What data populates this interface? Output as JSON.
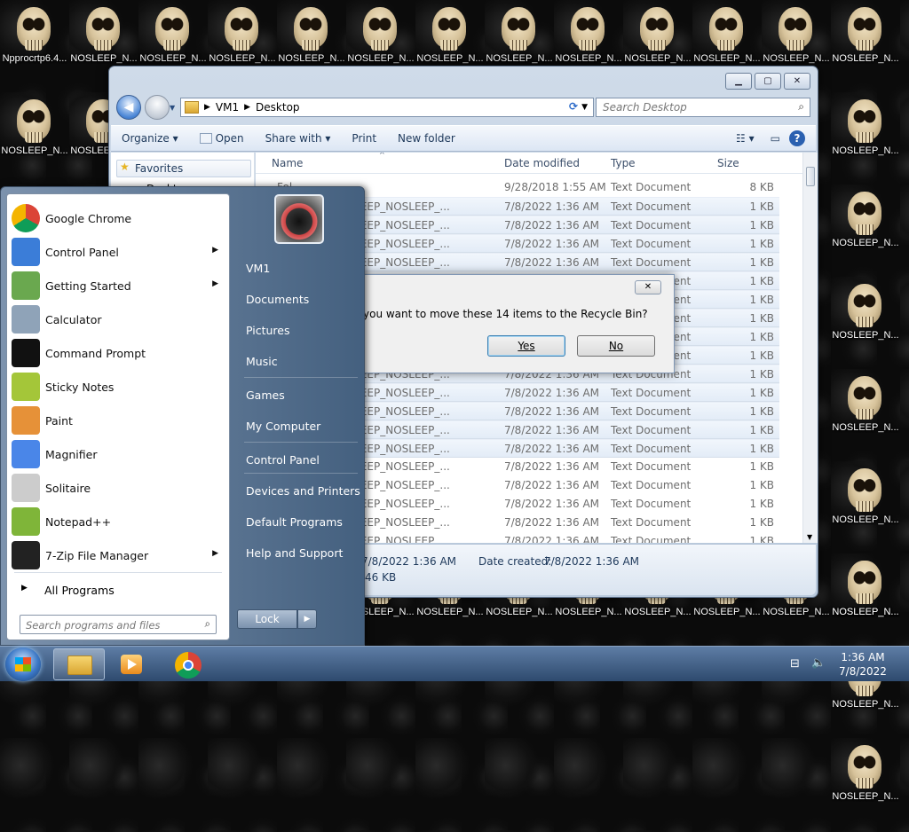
{
  "desktop": {
    "top_row": [
      "NOSLEEP_N...",
      "NOSLEEP_N...",
      "NOSLEEP_N...",
      "NOSLEEP_N...",
      "NOSLEEP_N...",
      "NOSLEEP_N...",
      "NOSLEEP_N...",
      "NOSLEEP_N...",
      "NOSLEEP_N...",
      "NOSLEEP_N...",
      "NOSLEEP_N...",
      "NOSLEEP_N...",
      "NOSLEEP_N..."
    ],
    "first_icon_label": "Npprocrtp6.4...",
    "left_col": [
      "NOSLEEP_N...",
      "NOSLEEP_N..."
    ],
    "right_col": [
      "NOSLEEP_N...",
      "NOSLEEP_N...",
      "NOSLEEP_N...",
      "NOSLEEP_N...",
      "NOSLEEP_N...",
      "NOSLEEP_N...",
      "NOSLEEP_N...",
      "NOSLEEP_N..."
    ],
    "bottom_row": [
      "NOSLEEP_N...",
      "NOSLEEP_N...",
      "NOSLEEP_N...",
      "NOSLEEP_N...",
      "NOSLEEP_N...",
      "NOSLEEP_N...",
      "NOSLEEP_N...",
      "NOSLEEP_N..."
    ]
  },
  "explorer": {
    "breadcrumb": [
      "VM1",
      "Desktop"
    ],
    "search_placeholder": "Search Desktop",
    "toolbar": {
      "organize": "Organize",
      "open": "Open",
      "share": "Share with",
      "print": "Print",
      "new_folder": "New folder"
    },
    "nav": {
      "favorites": "Favorites",
      "desktop": "Desktop"
    },
    "columns": {
      "name": "Name",
      "date": "Date modified",
      "type": "Type",
      "size": "Size"
    },
    "rows": [
      {
        "name": "Fol...",
        "date": "9/28/2018 1:55 AM",
        "type": "Text Document",
        "size": "8 KB",
        "sel": false
      },
      {
        "name": "NOSLEEP_NOSLEEP_NOSLEEP_...",
        "date": "7/8/2022 1:36 AM",
        "type": "Text Document",
        "size": "1 KB",
        "sel": true
      },
      {
        "name": "NOSLEEP_NOSLEEP_NOSLEEP_...",
        "date": "7/8/2022 1:36 AM",
        "type": "Text Document",
        "size": "1 KB",
        "sel": true
      },
      {
        "name": "NOSLEEP_NOSLEEP_NOSLEEP_...",
        "date": "7/8/2022 1:36 AM",
        "type": "Text Document",
        "size": "1 KB",
        "sel": true
      },
      {
        "name": "NOSLEEP_NOSLEEP_NOSLEEP_...",
        "date": "7/8/2022 1:36 AM",
        "type": "Text Document",
        "size": "1 KB",
        "sel": true
      },
      {
        "name": "NOSLEEP_NOSLEEP_NOSLEEP_...",
        "date": "7/8/2022 1:36 AM",
        "type": "Text Document",
        "size": "1 KB",
        "sel": true
      },
      {
        "name": "NOSLEEP_NOSLEEP_NOSLEEP_...",
        "date": "7/8/2022 1:36 AM",
        "type": "Text Document",
        "size": "1 KB",
        "sel": true
      },
      {
        "name": "NOSLEEP_NOSLEEP_NOSLEEP_...",
        "date": "7/8/2022 1:36 AM",
        "type": "Text Document",
        "size": "1 KB",
        "sel": true
      },
      {
        "name": "NOSLEEP_NOSLEEP_NOSLEEP_...",
        "date": "7/8/2022 1:36 AM",
        "type": "Text Document",
        "size": "1 KB",
        "sel": true
      },
      {
        "name": "NOSLEEP_NOSLEEP_NOSLEEP_...",
        "date": "7/8/2022 1:36 AM",
        "type": "Text Document",
        "size": "1 KB",
        "sel": true
      },
      {
        "name": "NOSLEEP_NOSLEEP_NOSLEEP_...",
        "date": "7/8/2022 1:36 AM",
        "type": "Text Document",
        "size": "1 KB",
        "sel": true
      },
      {
        "name": "NOSLEEP_NOSLEEP_NOSLEEP_...",
        "date": "7/8/2022 1:36 AM",
        "type": "Text Document",
        "size": "1 KB",
        "sel": true
      },
      {
        "name": "NOSLEEP_NOSLEEP_NOSLEEP_...",
        "date": "7/8/2022 1:36 AM",
        "type": "Text Document",
        "size": "1 KB",
        "sel": true
      },
      {
        "name": "NOSLEEP_NOSLEEP_NOSLEEP_...",
        "date": "7/8/2022 1:36 AM",
        "type": "Text Document",
        "size": "1 KB",
        "sel": true
      },
      {
        "name": "NOSLEEP_NOSLEEP_NOSLEEP_...",
        "date": "7/8/2022 1:36 AM",
        "type": "Text Document",
        "size": "1 KB",
        "sel": true
      },
      {
        "name": "NOSLEEP_NOSLEEP_NOSLEEP_...",
        "date": "7/8/2022 1:36 AM",
        "type": "Text Document",
        "size": "1 KB",
        "sel": false
      },
      {
        "name": "NOSLEEP_NOSLEEP_NOSLEEP_...",
        "date": "7/8/2022 1:36 AM",
        "type": "Text Document",
        "size": "1 KB",
        "sel": false
      },
      {
        "name": "NOSLEEP_NOSLEEP_NOSLEEP_...",
        "date": "7/8/2022 1:36 AM",
        "type": "Text Document",
        "size": "1 KB",
        "sel": false
      },
      {
        "name": "NOSLEEP_NOSLEEP_NOSLEEP_...",
        "date": "7/8/2022 1:36 AM",
        "type": "Text Document",
        "size": "1 KB",
        "sel": false
      },
      {
        "name": "NOSLEEP_NOSLEEP_NOSLEEP",
        "date": "7/8/2022 1:36 AM",
        "type": "Text Document",
        "size": "1 KB",
        "sel": false
      }
    ],
    "details": {
      "modified": "7/8/2022 1:36 AM",
      "created_label": "Date created:",
      "created": "7/8/2022 1:36 AM",
      "size": "46 KB"
    }
  },
  "dialog": {
    "message": "you want to move these 14 items to the Recycle Bin?",
    "yes": "Yes",
    "no": "No",
    "close": "✕"
  },
  "start_menu": {
    "programs": [
      {
        "label": "Google Chrome",
        "arrow": false,
        "color": "#db4437"
      },
      {
        "label": "Control Panel",
        "arrow": true,
        "color": "#3b7dd8"
      },
      {
        "label": "Getting Started",
        "arrow": true,
        "color": "#6aa84f"
      },
      {
        "label": "Calculator",
        "arrow": false,
        "color": "#8fa3b8"
      },
      {
        "label": "Command Prompt",
        "arrow": false,
        "color": "#111111"
      },
      {
        "label": "Sticky Notes",
        "arrow": false,
        "color": "#a4c639"
      },
      {
        "label": "Paint",
        "arrow": false,
        "color": "#e69138"
      },
      {
        "label": "Magnifier",
        "arrow": false,
        "color": "#4a86e8"
      },
      {
        "label": "Solitaire",
        "arrow": false,
        "color": "#cccccc"
      },
      {
        "label": "Notepad++",
        "arrow": false,
        "color": "#7fb539"
      },
      {
        "label": "7-Zip File Manager",
        "arrow": true,
        "color": "#222222"
      }
    ],
    "all_programs": "All Programs",
    "search_placeholder": "Search programs and files",
    "right": [
      "VM1",
      "Documents",
      "Pictures",
      "Music",
      "Games",
      "My Computer",
      "Control Panel",
      "Devices and Printers",
      "Default Programs",
      "Help and Support"
    ],
    "lock": "Lock"
  },
  "taskbar": {
    "time": "1:36 AM",
    "date": "7/8/2022"
  }
}
